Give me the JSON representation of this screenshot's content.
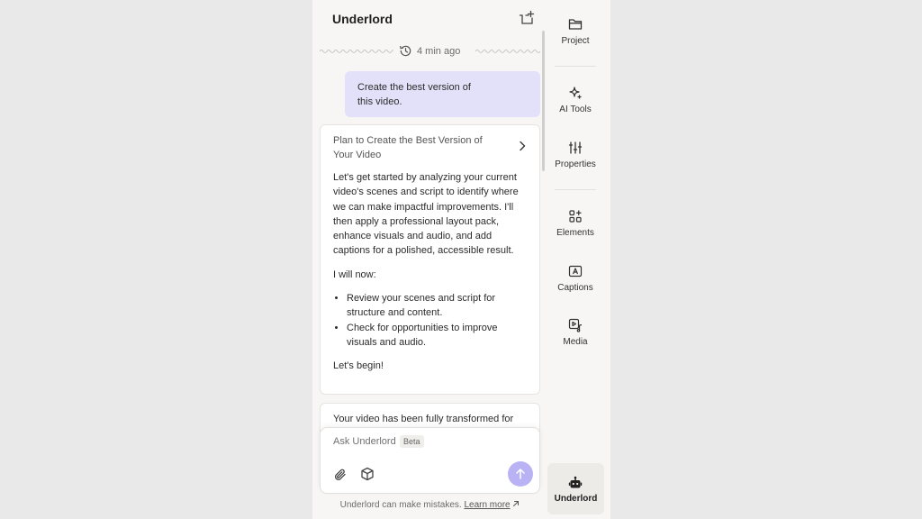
{
  "header": {
    "title": "Underlord",
    "new_chat_icon": "new-chat-icon"
  },
  "timestamp": {
    "text": "4 min ago",
    "icon": "history-clock-icon"
  },
  "user_message": {
    "line1": "Create the best version of",
    "line2": "this video."
  },
  "plan_card": {
    "title_line1": "Plan to Create the Best Version of",
    "title_line2": "Your Video",
    "paragraph1": "Let's get started by analyzing your current video's scenes and script to identify where we can make impactful improvements. I'll then apply a professional layout pack, enhance visuals and audio, and add captions for a polished, accessible result.",
    "paragraph2": "I will now:",
    "bullets": [
      "Review your scenes and script for structure and content.",
      "Check for opportunities to improve visuals and audio."
    ],
    "paragraph3": "Let's begin!"
  },
  "second_card": {
    "text": "Your video has been fully transformed for"
  },
  "input": {
    "placeholder": "Ask Underlord",
    "badge": "Beta"
  },
  "disclaimer": {
    "text": "Underlord can make mistakes. ",
    "link": "Learn more"
  },
  "rail": {
    "items": [
      {
        "label": "Project",
        "icon": "folder-icon"
      },
      {
        "label": "AI Tools",
        "icon": "sparkle-icon"
      },
      {
        "label": "Properties",
        "icon": "sliders-icon"
      },
      {
        "label": "Elements",
        "icon": "elements-icon"
      },
      {
        "label": "Captions",
        "icon": "captions-icon"
      },
      {
        "label": "Media",
        "icon": "media-icon"
      }
    ],
    "active": {
      "label": "Underlord",
      "icon": "robot-icon"
    }
  },
  "colors": {
    "accent": "#b9b3f5",
    "user_bubble": "#e3e1f9",
    "panel_bg": "#f7f6f4"
  }
}
